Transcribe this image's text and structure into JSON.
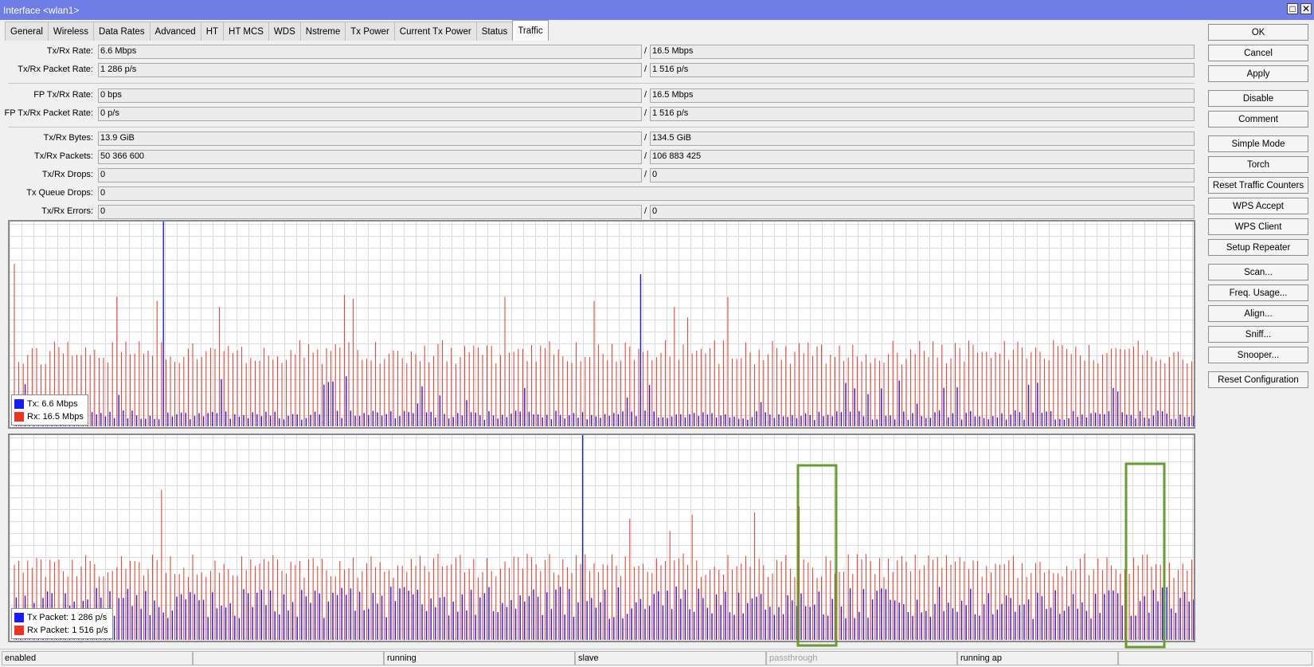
{
  "window": {
    "title": "Interface <wlan1>",
    "restore_glyph": "□",
    "close_glyph": "✕"
  },
  "tabs": [
    "General",
    "Wireless",
    "Data Rates",
    "Advanced",
    "HT",
    "HT MCS",
    "WDS",
    "Nstreme",
    "Tx Power",
    "Current Tx Power",
    "Status",
    "Traffic"
  ],
  "active_tab": "Traffic",
  "stats": {
    "txrx_rate": {
      "label": "Tx/Rx Rate:",
      "tx": "6.6 Mbps",
      "rx": "16.5 Mbps"
    },
    "txrx_packet_rate": {
      "label": "Tx/Rx Packet Rate:",
      "tx": "1 286 p/s",
      "rx": "1 516 p/s"
    },
    "fp_txrx_rate": {
      "label": "FP Tx/Rx Rate:",
      "tx": "0 bps",
      "rx": "16.5 Mbps"
    },
    "fp_txrx_packet_rate": {
      "label": "FP Tx/Rx Packet Rate:",
      "tx": "0 p/s",
      "rx": "1 516 p/s"
    },
    "txrx_bytes": {
      "label": "Tx/Rx Bytes:",
      "tx": "13.9 GiB",
      "rx": "134.5 GiB"
    },
    "txrx_packets": {
      "label": "Tx/Rx Packets:",
      "tx": "50 366 600",
      "rx": "106 883 425"
    },
    "txrx_drops": {
      "label": "Tx/Rx Drops:",
      "tx": "0",
      "rx": "0"
    },
    "tx_queue_drops": {
      "label": "Tx Queue Drops:",
      "value": "0"
    },
    "txrx_errors": {
      "label": "Tx/Rx Errors:",
      "tx": "0",
      "rx": "0"
    },
    "separator": "/"
  },
  "colors": {
    "tx": "#1a1aff",
    "rx": "#ee3322",
    "highlight": "#6a9a32",
    "grid": "#dcdcdc"
  },
  "chart_data": [
    {
      "type": "bar",
      "legend": [
        {
          "name": "Tx:",
          "value": "6.6 Mbps"
        },
        {
          "name": "Rx:",
          "value": "16.5 Mbps"
        }
      ],
      "legend_placement": "bottom-left",
      "grid": true,
      "ylim": [
        0,
        1
      ],
      "series_note_tx_spikes": [
        0.56,
        0.24,
        0.31,
        0.19,
        0.17,
        0.17,
        0.11,
        0.13
      ],
      "rx_peak_values": [
        0.79,
        0.63,
        0.61,
        0.58,
        0.64,
        0.62,
        0.63,
        0.61,
        0.58,
        0.53,
        0.63
      ],
      "tx_peak_values": [
        1.0,
        0.74,
        0.66,
        0.37
      ]
    },
    {
      "type": "bar",
      "legend": [
        {
          "name": "Tx Packet:",
          "value": "1 286 p/s"
        },
        {
          "name": "Rx Packet:",
          "value": "1 516 p/s"
        }
      ],
      "legend_placement": "bottom-left",
      "grid": true,
      "ylim": [
        0,
        1
      ],
      "rx_peak_values": [
        0.73,
        0.59,
        0.53,
        0.61,
        0.62,
        0.65
      ],
      "tx_peak_values": [
        1.0,
        0.81,
        0.83,
        0.56,
        0.47
      ]
    }
  ],
  "buttons": [
    "OK",
    "Cancel",
    "Apply",
    "Disable",
    "Comment",
    "Simple Mode",
    "Torch",
    "Reset Traffic Counters",
    "WPS Accept",
    "WPS Client",
    "Setup Repeater",
    "Scan...",
    "Freq. Usage...",
    "Align...",
    "Sniff...",
    "Snooper...",
    "Reset Configuration"
  ],
  "status": [
    "enabled",
    "",
    "running",
    "slave",
    "passthrough",
    "running ap",
    ""
  ]
}
